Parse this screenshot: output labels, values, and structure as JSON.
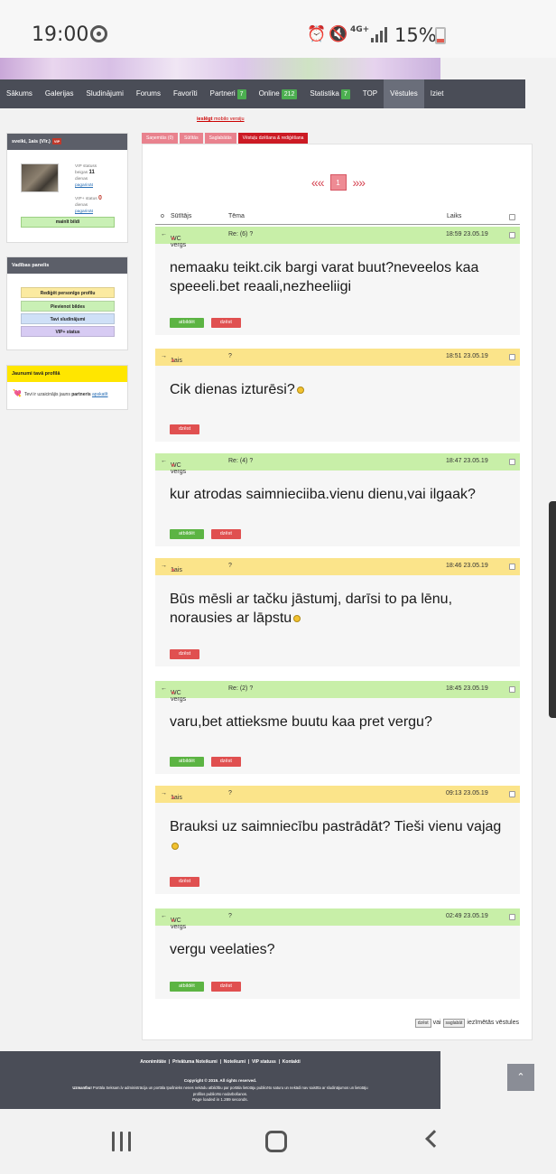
{
  "statusbar": {
    "time": "19:00",
    "network": "4G+",
    "battery": "15%"
  },
  "nav": {
    "items": [
      {
        "label": "Sākums"
      },
      {
        "label": "Galerijas"
      },
      {
        "label": "Sludinājumi"
      },
      {
        "label": "Forums"
      },
      {
        "label": "Favorīti"
      },
      {
        "label": "Partneri",
        "badge": "7"
      },
      {
        "label": "Online",
        "badge": "212"
      },
      {
        "label": "Statistika",
        "badge": "7"
      },
      {
        "label": "TOP"
      },
      {
        "label": "Vēstules",
        "active": true
      },
      {
        "label": "Iziet"
      }
    ]
  },
  "mobile_link": {
    "prefix": "ieslēgt",
    "text": "mobilo versiju"
  },
  "sidebar": {
    "user_header": "sveiki, 1ais (Vīr.)",
    "vip_tag": "VIP",
    "vip_status_label": "VIP statuss",
    "vip_ends": "beigas",
    "vip_days": "11",
    "vip_days_unit": "dienas",
    "vip_extend": "pagarināt",
    "vip_plus_label": "VIP+ status",
    "vip_plus_days": "0",
    "vip_plus_unit": "dienas",
    "vip_plus_extend": "pagarināt",
    "change_photo": "mainīt bildi",
    "panel_header": "Vadības panelis",
    "panel_buttons": [
      {
        "label": "Rediģēt personīgo profilu",
        "color": "#fbeaa0"
      },
      {
        "label": "Pievienot bildes",
        "color": "#c9f0b5"
      },
      {
        "label": "Tavi sludinājumi",
        "color": "#cfe0f7"
      },
      {
        "label": "VIP+ status",
        "color": "#d7cbf3"
      }
    ],
    "notif_header": "Jaunumi tavā profilā",
    "notif_text": "Tevi ir uzaicinājis jauns",
    "notif_bold": "partneris",
    "notif_link": "apskatīt"
  },
  "tabs": [
    {
      "label": "Saņemtās (0)"
    },
    {
      "label": "Sūtītās"
    },
    {
      "label": "Saglabātās"
    },
    {
      "label": "Vēstuļu dzēšana & rediģēšana",
      "active": true
    }
  ],
  "pager": {
    "prev": "«« ",
    "current": "1",
    "next": " »»"
  },
  "table": {
    "col_sender": "Sūtītājs",
    "col_subject": "Tēma",
    "col_time": "Laiks",
    "sort_marker": "o"
  },
  "messages": [
    {
      "color": "green",
      "arrow": "←",
      "sender": "WC vergs",
      "subject": "Re: (6) ?",
      "time": "18:59 23.05.19",
      "text": "nemaaku teikt.cik bargi varat buut?neveelos kaa speeeli.bet reaali,nezheeliigi",
      "emoji": false,
      "reply": "atbildēt",
      "delete": "dzēst"
    },
    {
      "color": "yellow",
      "arrow": "→",
      "sender": "1ais",
      "subject": "?",
      "time": "18:51 23.05.19",
      "text": "Cik dienas izturēsi?",
      "emoji": true,
      "reply": "",
      "delete": "dzēst"
    },
    {
      "color": "green",
      "arrow": "←",
      "sender": "WC vergs",
      "subject": "Re: (4) ?",
      "time": "18:47 23.05.19",
      "text": "kur atrodas saimnieciiba.vienu dienu,vai ilgaak?",
      "emoji": false,
      "reply": "atbildēt",
      "delete": "dzēst"
    },
    {
      "color": "yellow",
      "arrow": "→",
      "sender": "1ais",
      "subject": "?",
      "time": "18:46 23.05.19",
      "text": "Būs mēsli ar tačku jāstumj, darīsi to pa lēnu, norausies ar lāpstu",
      "emoji": true,
      "reply": "",
      "delete": "dzēst"
    },
    {
      "color": "green",
      "arrow": "←",
      "sender": "WC vergs",
      "subject": "Re: (2) ?",
      "time": "18:45 23.05.19",
      "text": "varu,bet attieksme buutu kaa pret vergu?",
      "emoji": false,
      "reply": "atbildēt",
      "delete": "dzēst"
    },
    {
      "color": "yellow",
      "arrow": "→",
      "sender": "1ais",
      "subject": "?",
      "time": "09:13 23.05.19",
      "text": "Brauksi uz saimniecību pastrādāt? Tieši vienu vajag",
      "emoji": true,
      "reply": "",
      "delete": "dzēst"
    },
    {
      "color": "green",
      "arrow": "←",
      "sender": "WC vergs",
      "subject": "?",
      "time": "02:49 23.05.19",
      "text": "vergu veelaties?",
      "emoji": false,
      "reply": "atbildēt",
      "delete": "dzēst"
    }
  ],
  "bulk": {
    "delete": "dzēst",
    "or": "vai",
    "save": "saglabāt",
    "suffix": "iezīmētās vēstules"
  },
  "footer": {
    "links": [
      "Anonimitāte",
      "Privātuma Noteikumi",
      "Noteikumi",
      "VIP statuss",
      "Kontakti"
    ],
    "copyright": "Copyright © 2019. All rights reserved.",
    "disclaimer_bold": "Uzmanību!",
    "disclaimer": "Portāla Seksam.lv administrācija un portāla īpašnieks nenes nekādu atbildību par portāla lietotāju publicēto saturu un nekādi nav saistīta ar sludinājumos un lietotāju profilos publicēto nodarbošanos.",
    "loaded": "Page loaded in 1.289 seconds."
  }
}
